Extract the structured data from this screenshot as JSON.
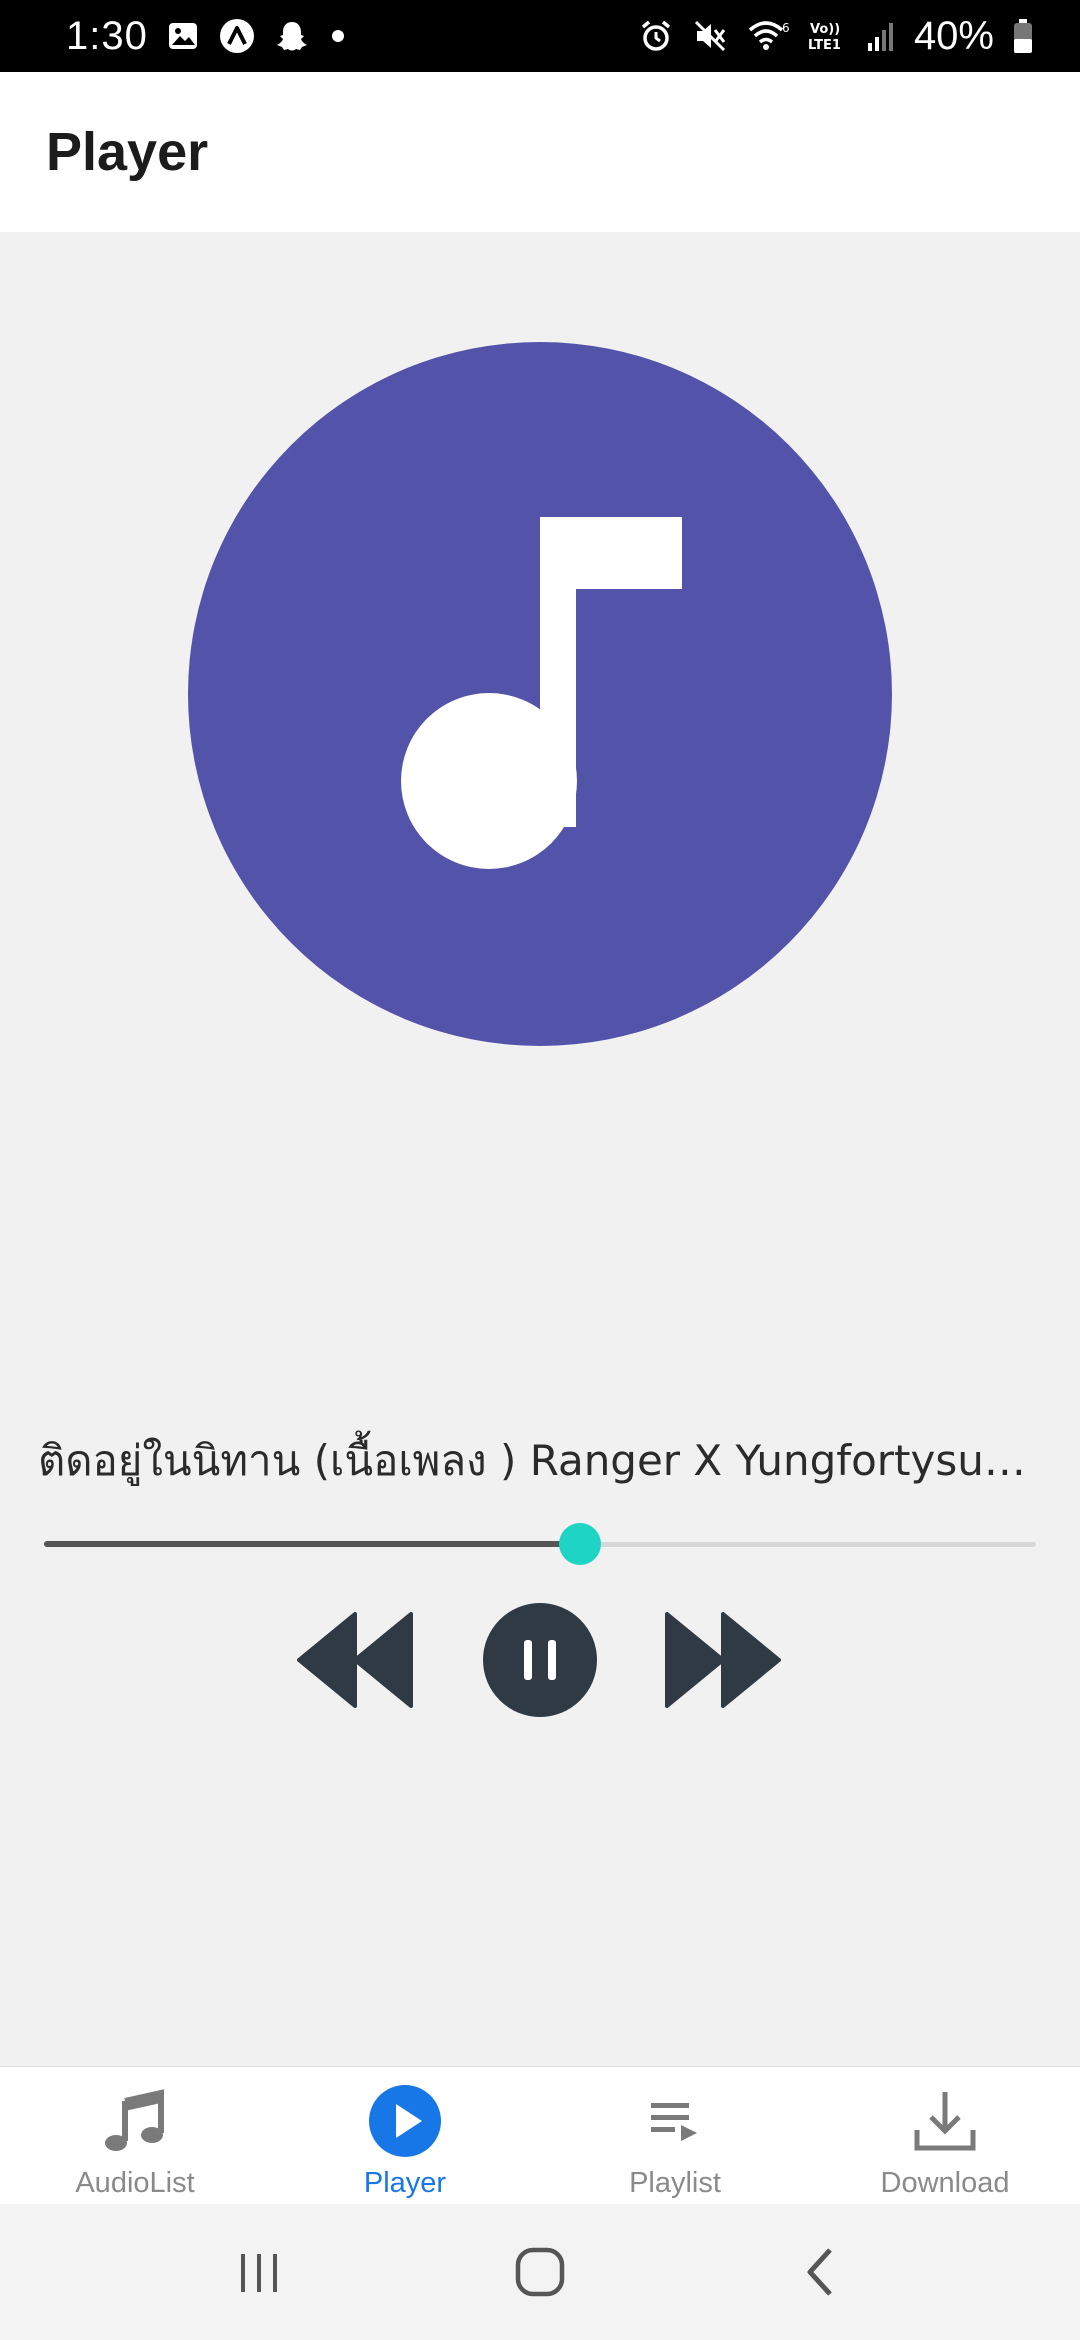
{
  "status_bar": {
    "time": "1:30",
    "battery": "40%",
    "left_icons": [
      "gallery-icon",
      "app-icon",
      "snapchat-icon",
      "dot-icon"
    ],
    "right_icons": [
      "alarm-icon",
      "mute-icon",
      "wifi-icon",
      "volte-icon",
      "signal-icon",
      "battery-icon"
    ],
    "volte_text": "Vo)) LTE1"
  },
  "header": {
    "title": "Player"
  },
  "player": {
    "artwork_icon": "music-note-icon",
    "artwork_color": "#5453aa",
    "track_title": "ติดอยู่ในนิทาน (เนื้อเพลง ) Ranger X Yungfortysux...",
    "progress": 0.54,
    "accent_color": "#1ed4c4",
    "controls": {
      "prev_icon": "rewind-icon",
      "play_pause_icon": "pause-icon",
      "next_icon": "fast-forward-icon"
    }
  },
  "bottom_nav": {
    "active": "Player",
    "active_color": "#1877e6",
    "items": [
      {
        "label": "AudioList",
        "icon": "music-notes-icon"
      },
      {
        "label": "Player",
        "icon": "play-circle-icon"
      },
      {
        "label": "Playlist",
        "icon": "playlist-icon"
      },
      {
        "label": "Download",
        "icon": "download-icon"
      }
    ]
  },
  "system_nav": {
    "buttons": [
      "recents-icon",
      "home-icon",
      "back-icon"
    ]
  }
}
